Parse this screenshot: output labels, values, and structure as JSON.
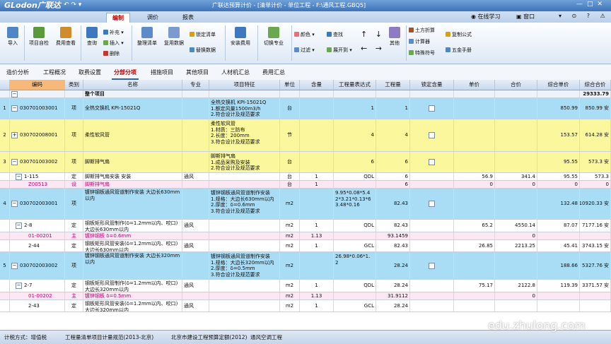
{
  "window": {
    "logo": "GLodon广联达",
    "title": "广联达预算计价 - [清单计价 - 单位工程 - F:\\通风工程.GBQ5]"
  },
  "menu": {
    "tabs": [
      "编制",
      "调价",
      "报表"
    ],
    "active_index": 0,
    "right_items": [
      "在线学习",
      "窗口"
    ]
  },
  "ribbon": {
    "import": "导入",
    "check": "项目自检",
    "batch": "费用查看",
    "query": "查询",
    "supplement": "补充",
    "insert": "插入",
    "delete": "删除",
    "organize": "整理清单",
    "reuse": "复用数据",
    "lock": "锁定清单",
    "replace": "替换数据",
    "install_fee": "安装费用",
    "switch_major": "切换专业",
    "color": "颜色",
    "filter": "过滤",
    "find": "查找",
    "expand": "展开到",
    "other": "其他",
    "earth_calc": "土方折算",
    "calculator": "计算器",
    "special_symbol": "特殊符号",
    "copy_formula": "复制公式",
    "wujin": "五金手册"
  },
  "page_tabs": [
    "造价分析",
    "工程概况",
    "取费设置",
    "分部分项",
    "措施项目",
    "其他项目",
    "人材机汇总",
    "费用汇总"
  ],
  "active_page_tab": 3,
  "grid": {
    "columns": [
      "编码",
      "类别",
      "名称",
      "专业",
      "项目特征",
      "单位",
      "含量",
      "工程量表达式",
      "工程量",
      "锁定含量",
      "单价",
      "合价",
      "综合单价",
      "综合合价"
    ],
    "total_row": {
      "code": "",
      "name": "整个项目",
      "total": "29333.79"
    },
    "rows": [
      {
        "num": "1",
        "code": "030701003001",
        "type": "项",
        "name": "全热交换机 KPI-15021Q",
        "major": "",
        "feature": "全热交换机 KPI-15021Q\n1.额定风量1500m3/h\n2.符合设计及规范要求",
        "unit": "台",
        "qty_ratio": "",
        "expr": "1",
        "qty": "1",
        "unit_price": "",
        "price": "",
        "comp_price": "850.99",
        "comp_total": "850.99",
        "suffix": "安",
        "kind": "item-blue",
        "h": 30
      },
      {
        "num": "2",
        "code": "030702008001",
        "type": "项",
        "name": "柔性软风管",
        "major": "",
        "feature": "柔性软风管\n1.材质：三防布\n2.长度：200mm\n3.符合设计及规范要求",
        "unit": "节",
        "qty_ratio": "",
        "expr": "4",
        "qty": "4",
        "unit_price": "",
        "price": "",
        "comp_price": "153.57",
        "comp_total": "614.28",
        "suffix": "安",
        "kind": "item-yellow",
        "h": 46
      },
      {
        "num": "3",
        "code": "030701003002",
        "type": "项",
        "name": "脚斯排气扇",
        "major": "",
        "feature": "脚斯排气扇\n1.成品采购及安装\n2.符合设计及规范要求",
        "unit": "台",
        "qty_ratio": "",
        "expr": "6",
        "qty": "6",
        "unit_price": "",
        "price": "",
        "comp_price": "95.55",
        "comp_total": "573.3",
        "suffix": "安",
        "kind": "item-yellow",
        "h": 30
      },
      {
        "num": "",
        "code": "1-115",
        "type": "定",
        "name": "脚斯排气扇安装 安装",
        "major": "通风",
        "feature": "",
        "unit": "台",
        "qty_ratio": "1",
        "expr": "QDL",
        "qty": "6",
        "unit_price": "56.9",
        "price": "341.4",
        "comp_price": "95.55",
        "comp_total": "573.3",
        "suffix": "",
        "kind": "sub-white",
        "h": 11
      },
      {
        "num": "",
        "code": "Z00513",
        "type": "设",
        "name": "脚斯排气扇",
        "major": "",
        "feature": "",
        "unit": "台",
        "qty_ratio": "1",
        "expr": "",
        "qty": "6",
        "unit_price": "0",
        "price": "0",
        "comp_price": "0",
        "comp_total": "0",
        "suffix": "",
        "kind": "sub-pink",
        "h": 11
      },
      {
        "num": "4",
        "code": "030702003001",
        "type": "项",
        "name": "镀锌钢板通风管道制作安装 大边长630mm以内",
        "major": "",
        "feature": "镀锌钢板通风管道制作安装\n1.规格：大边长630mm以内\n2.厚度：δ=0.6mm\n3.符合设计及规范要求",
        "unit": "m2",
        "qty_ratio": "",
        "expr": "9.95*0.08*5.4\n2*3.21*0.13*6\n3.48*0.16",
        "qty": "82.43",
        "unit_price": "",
        "price": "",
        "comp_price": "132.48",
        "comp_total": "10920.33",
        "suffix": "安",
        "kind": "item-blue",
        "h": 44
      },
      {
        "num": "",
        "code": "2-8",
        "type": "定",
        "name": "钢板矩形风管制作(δ=1.2mm以内、咬口)大边长630mm以内",
        "major": "通风",
        "feature": "",
        "unit": "m2",
        "qty_ratio": "1",
        "expr": "QDL",
        "qty": "82.43",
        "unit_price": "65.2",
        "price": "4550.14",
        "comp_price": "87.07",
        "comp_total": "7177.16",
        "suffix": "安",
        "kind": "sub-white",
        "h": 18
      },
      {
        "num": "",
        "code": "01-00201",
        "type": "主",
        "name": "镀锌钢板 δ=0.6mm",
        "major": "",
        "feature": "",
        "unit": "m2",
        "qty_ratio": "1.13",
        "expr": "",
        "qty": "93.1459",
        "unit_price": "",
        "price": "0",
        "comp_price": "",
        "comp_total": "",
        "suffix": "",
        "kind": "sub-pink",
        "h": 11
      },
      {
        "num": "",
        "code": "2-44",
        "type": "定",
        "name": "钢板矩形风管安装(δ=1.2mm以内、咬口)大边长630mm以内",
        "major": "通风",
        "feature": "",
        "unit": "m2",
        "qty_ratio": "1",
        "expr": "GCL",
        "qty": "82.43",
        "unit_price": "26.85",
        "price": "2213.25",
        "comp_price": "45.41",
        "comp_total": "3743.15",
        "suffix": "安",
        "kind": "sub-white",
        "h": 17
      },
      {
        "num": "5",
        "code": "030702003002",
        "type": "项",
        "name": "镀锌钢板通风管道制作安装 大边长320mm以内",
        "major": "",
        "feature": "镀锌钢板通风管道制作安装\n1.规格：大边长320mm以内\n2.厚度：δ=0.5mm\n3.符合设计及规范要求",
        "unit": "m2",
        "qty_ratio": "",
        "expr": "26.98*0.06*1.\n2",
        "qty": "28.24",
        "unit_price": "",
        "price": "",
        "comp_price": "188.66",
        "comp_total": "5327.76",
        "suffix": "安",
        "kind": "item-blue",
        "h": 39
      },
      {
        "num": "",
        "code": "2-7",
        "type": "定",
        "name": "钢板矩形风管制作(δ=1.2mm以内、咬口)大边长320mm以内",
        "major": "通风",
        "feature": "",
        "unit": "m2",
        "qty_ratio": "1",
        "expr": "QDL",
        "qty": "28.24",
        "unit_price": "75.17",
        "price": "2122.8",
        "comp_price": "119.39",
        "comp_total": "3371.57",
        "suffix": "安",
        "kind": "sub-white",
        "h": 18
      },
      {
        "num": "",
        "code": "01-00202",
        "type": "主",
        "name": "镀锌钢板 δ=0.5mm",
        "major": "",
        "feature": "",
        "unit": "m2",
        "qty_ratio": "1.13",
        "expr": "",
        "qty": "31.9112",
        "unit_price": "",
        "price": "0",
        "comp_price": "",
        "comp_total": "",
        "suffix": "",
        "kind": "sub-pink",
        "h": 11
      },
      {
        "num": "",
        "code": "2-43",
        "type": "定",
        "name": "钢板矩形风管安装(δ=1.2mm以内、咬口)大边长320mm以内",
        "major": "通风",
        "feature": "",
        "unit": "m2",
        "qty_ratio": "1",
        "expr": "GCL",
        "qty": "28.24",
        "unit_price": "",
        "price": "",
        "comp_price": "",
        "comp_total": "",
        "suffix": "",
        "kind": "sub-white",
        "h": 17
      }
    ]
  },
  "status": {
    "calc_method": "计税方式：增值税",
    "standard": "工程量清单项目计量规范(2013-北京)",
    "quota": "北京市建设工程预算定额(2012)",
    "major": "通风空调工程"
  },
  "watermark": "edu.zhulong.com",
  "colors": {
    "item_blue": "#a9dcf5",
    "item_yellow": "#faf79c",
    "sub_pink": "#fde7f2",
    "header_selected": "#f6b97a",
    "active_tab_text": "#c00000",
    "title_blue": "#3d74b8"
  }
}
